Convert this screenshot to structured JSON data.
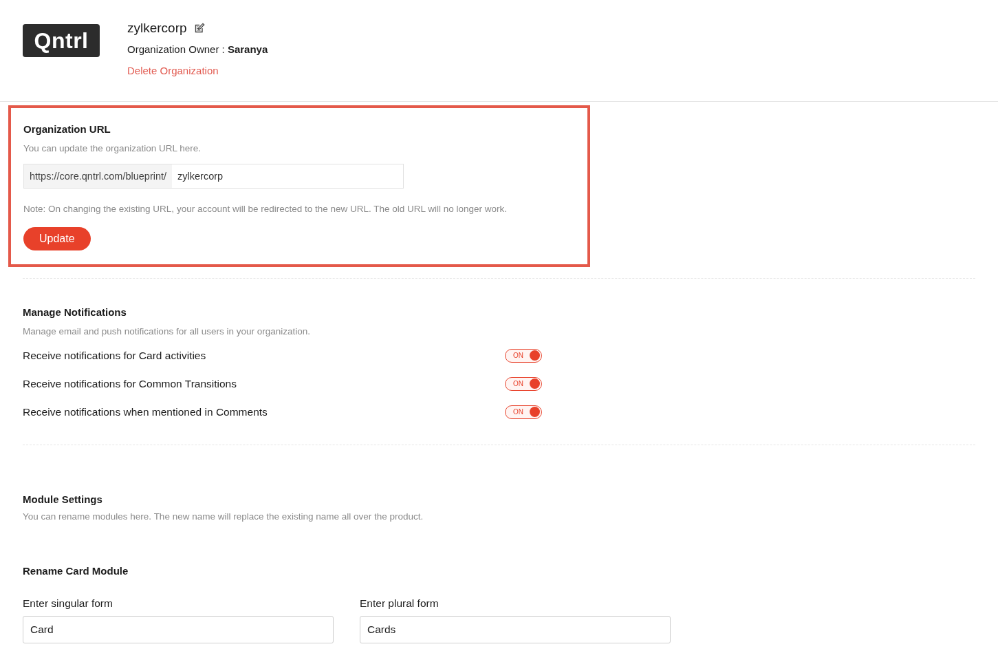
{
  "header": {
    "logo": "Qntrl",
    "org_name": "zylkercorp",
    "owner_label": "Organization Owner : ",
    "owner_name": "Saranya",
    "delete_link": "Delete Organization"
  },
  "org_url": {
    "title": "Organization URL",
    "description": "You can update the organization URL here.",
    "prefix": "https://core.qntrl.com/blueprint/",
    "value": "zylkercorp",
    "note": "Note: On changing the existing URL, your account will be redirected to the new URL. The old URL will no longer work.",
    "button": "Update"
  },
  "notifications": {
    "title": "Manage Notifications",
    "description": "Manage email and push notifications for all users in your organization.",
    "items": [
      {
        "label": "Receive notifications for Card activities",
        "toggle_text": "ON",
        "on": true
      },
      {
        "label": "Receive notifications for Common Transitions",
        "toggle_text": "ON",
        "on": true
      },
      {
        "label": "Receive notifications when mentioned in Comments",
        "toggle_text": "ON",
        "on": true
      }
    ]
  },
  "module_settings": {
    "title": "Module Settings",
    "description": "You can rename modules here. The new name will replace the existing name all over the product.",
    "rename_title": "Rename Card Module",
    "fields": [
      {
        "label": "Enter singular form",
        "value": "Card"
      },
      {
        "label": "Enter plural form",
        "value": "Cards"
      }
    ]
  }
}
